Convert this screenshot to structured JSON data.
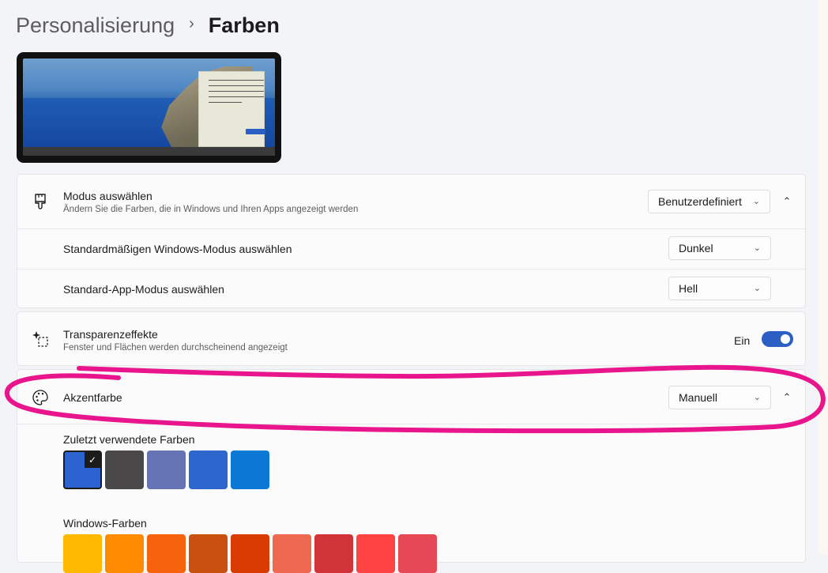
{
  "breadcrumb": {
    "parent": "Personalisierung",
    "separator": "›",
    "current": "Farben"
  },
  "mode": {
    "title": "Modus auswählen",
    "subtitle": "Ändern Sie die Farben, die in Windows und Ihren Apps angezeigt werden",
    "value": "Benutzerdefiniert",
    "windows_mode_label": "Standardmäßigen Windows-Modus auswählen",
    "windows_mode_value": "Dunkel",
    "app_mode_label": "Standard-App-Modus auswählen",
    "app_mode_value": "Hell"
  },
  "transparency": {
    "title": "Transparenzeffekte",
    "subtitle": "Fenster und Flächen werden durchscheinend angezeigt",
    "state": "Ein",
    "on": true
  },
  "accent": {
    "title": "Akzentfarbe",
    "value": "Manuell",
    "recent_label": "Zuletzt verwendete Farben",
    "recent_colors": [
      "#2c63d1",
      "#4a4848",
      "#6673b5",
      "#2d66cc",
      "#0b78d6"
    ],
    "selected_index": 0,
    "windows_label": "Windows-Farben",
    "windows_colors": [
      "#ffb900",
      "#ff8c00",
      "#f7630c",
      "#ca5010",
      "#da3b01",
      "#ef6950",
      "#d13438",
      "#ff4343",
      "#e74856"
    ]
  },
  "icons": {
    "mode": "brush-icon",
    "transparency": "transparency-sparkle-icon",
    "accent": "palette-icon",
    "chevron_down": "chevron-down-icon",
    "chevron_up": "chevron-up-icon",
    "check": "checkmark-icon"
  },
  "colors": {
    "accent": "#2c5fc3",
    "annotation": "#e8158c"
  }
}
